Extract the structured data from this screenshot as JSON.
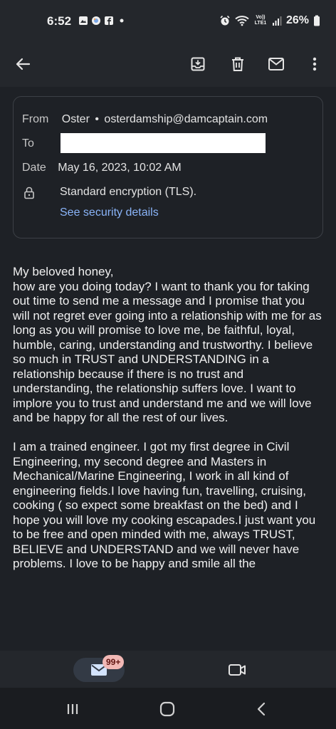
{
  "status_bar": {
    "time": "6:52",
    "left_icons": [
      "gallery-icon",
      "browser-icon",
      "facebook-icon",
      "dot-icon"
    ],
    "right_icons": [
      "alarm-icon",
      "wifi-icon",
      "volte-icon",
      "signal-icon",
      "battery-icon"
    ],
    "volte_label": "Vo)) LTE1",
    "battery": "26%"
  },
  "toolbar": {
    "back": "back-arrow-icon",
    "actions": [
      "archive-icon",
      "delete-icon",
      "mark-unread-icon",
      "more-vert-icon"
    ]
  },
  "email": {
    "from_label": "From",
    "from_name": "Oster",
    "separator": "•",
    "from_email": "osterdamship@damcaptain.com",
    "to_label": "To",
    "date_label": "Date",
    "date_value": "May 16, 2023, 10:02 AM",
    "encryption": "Standard encryption (TLS).",
    "security_link": "See security details"
  },
  "body": {
    "paragraphs": [
      "My beloved honey,\nhow are you doing today? I want to thank you for taking out time to send me a message and I promise that you will not regret ever going into a relationship with me for as long as you will promise to love me, be faithful, loyal, humble, caring, understanding and trustworthy. I believe so much in TRUST and UNDERSTANDING in a relationship because if there is no trust and understanding, the relationship suffers love. I want to implore you to trust and understand me and we will love and be happy for all the rest of our lives.",
      "I am a trained engineer. I got my first degree in Civil Engineering, my second degree and Masters in Mechanical/Marine Engineering, I work in all kind of engineering fields.I love having fun, travelling, cruising, cooking ( so expect some breakfast on the bed) and I hope you will love my cooking escapades.I just want you to be free and open minded with me, always TRUST, BELIEVE and UNDERSTAND and we will never have problems. I love to be happy and smile all the"
    ]
  },
  "bottom_nav": {
    "mail_badge": "99+"
  },
  "colors": {
    "background": "#1e2126",
    "link": "#8ab4f8",
    "badge_bg": "#f2b8b5"
  }
}
